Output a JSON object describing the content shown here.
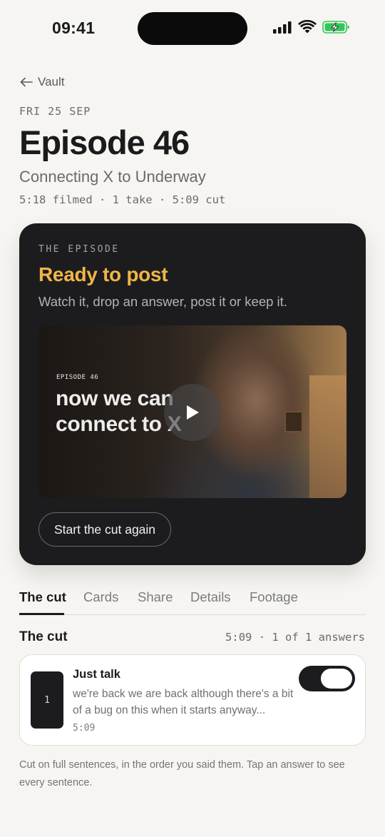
{
  "status_bar": {
    "time": "09:41",
    "icons": [
      "cellular-signal-icon",
      "wifi-icon",
      "battery-charging-icon"
    ],
    "battery_color": "#33c759"
  },
  "nav": {
    "back_label": "Vault",
    "back_icon": "arrow-left-icon"
  },
  "header": {
    "date": "FRI 25 SEP",
    "title": "Episode 46",
    "subtitle": "Connecting X to Underway",
    "meta": "5:18 filmed · 1 take · 5:09 cut"
  },
  "episode_card": {
    "eyebrow": "THE EPISODE",
    "status_title": "Ready to post",
    "status_color": "#f0b646",
    "description": "Watch it, drop an answer, post it or keep it.",
    "video": {
      "overlay_label": "EPISODE 46",
      "overlay_line1": "now we can",
      "overlay_line2": "connect to X",
      "play_icon": "play-icon"
    },
    "restart_label": "Start the cut again"
  },
  "tabs": {
    "items": [
      "The cut",
      "Cards",
      "Share",
      "Details",
      "Footage"
    ],
    "active": "The cut"
  },
  "cut_section": {
    "heading": "The cut",
    "meta": "5:09 · 1 of 1 answers",
    "answers": [
      {
        "index": "1",
        "title": "Just talk",
        "excerpt": "we're back we are back although there's a bit of a bug on this when it starts anyway...",
        "duration": "5:09",
        "enabled": true
      }
    ],
    "footer_note": "Cut on full sentences, in the order you said them. Tap an answer to see every sentence."
  }
}
